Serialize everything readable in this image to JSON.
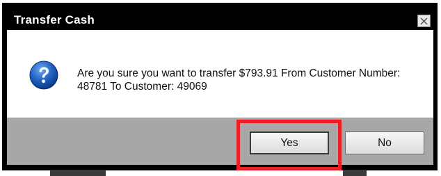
{
  "dialog": {
    "title": "Transfer Cash",
    "message": "Are you sure you want to transfer $793.91 From Customer Number: 48781 To Customer: 49069",
    "icon": "question-icon",
    "buttons": {
      "yes_label": "Yes",
      "no_label": "No"
    },
    "close_icon": "close-icon"
  },
  "colors": {
    "highlight": "#ee1c25",
    "icon_blue": "#1d5fc0",
    "footer": "#a7a7a7"
  }
}
